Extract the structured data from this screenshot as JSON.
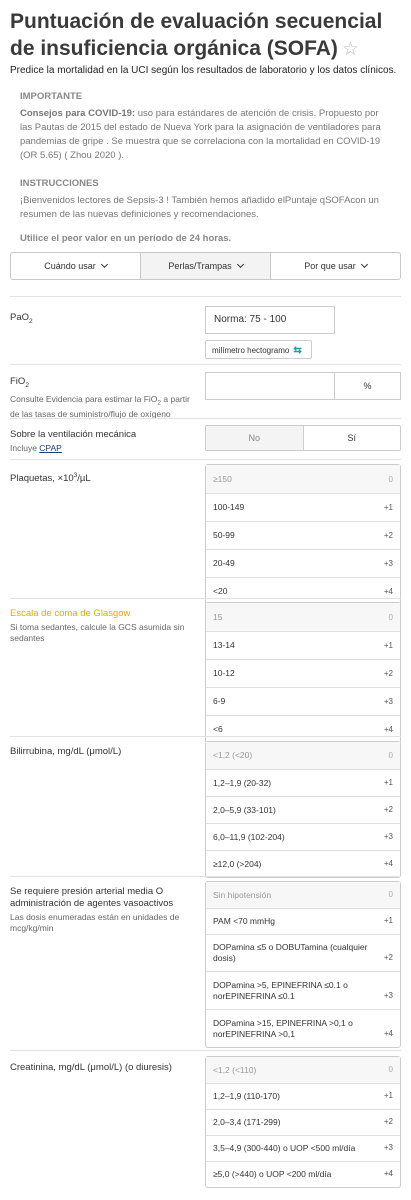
{
  "header": {
    "title": "Puntuación de evaluación secuencial de insuficiencia orgánica (SOFA)",
    "star_icon": "star-outline-icon",
    "subtitle": "Predice la mortalidad en la UCI según los resultados de laboratorio y los datos clínicos."
  },
  "important": {
    "heading": "IMPORTANTE",
    "lead": "Consejos para COVID-19:",
    "text": " uso para estándares de atención de crisis. Propuesto por las Pautas de 2015 del estado de Nueva York para la asignación de ventiladores para pandemias de gripe . Se muestra que se correlaciona con la mortalidad en COVID-19 (OR 5.65) ( Zhou 2020 )."
  },
  "instructions": {
    "heading": "INSTRUCCIONES",
    "text": "¡Bienvenidos lectores de Sepsis-3 ! También hemos añadido elPuntaje qSOFAcon un resumen de las nuevas definiciones y recomendaciones.",
    "emphasis": "Utilice el peor valor en un período de 24 horas."
  },
  "tabs": [
    {
      "label": "Cuándo usar"
    },
    {
      "label": "Perlas/Trampas"
    },
    {
      "label": "Por que usar"
    }
  ],
  "pao2": {
    "label_main": "PaO",
    "label_sub": "2",
    "placeholder": "Norma: 75 - 100",
    "unit": "milímetro hectogramo",
    "swap_icon": "swap-arrows-icon"
  },
  "fio2": {
    "label_main": "FiO",
    "label_sub": "2",
    "note_pre": "Consulte Evidencia para estimar la FiO",
    "note_sub": "2",
    "note_post": " a partir de las tasas de suministro/flujo de oxígeno",
    "unit": "%"
  },
  "ventilation": {
    "label": "Sobre la ventilación mecánica",
    "note_pre": "Incluye ",
    "note_link": "CPAP",
    "no": "No",
    "si": "Sí"
  },
  "platelets": {
    "label_pre": "Plaquetas, ×10",
    "label_sup": "3",
    "label_post": "/µL",
    "options": [
      {
        "label": "≥150",
        "points": "0"
      },
      {
        "label": "100-149",
        "points": "+1"
      },
      {
        "label": "50-99",
        "points": "+2"
      },
      {
        "label": "20-49",
        "points": "+3"
      },
      {
        "label": "<20",
        "points": "+4"
      }
    ]
  },
  "glasgow": {
    "label": "Escala de coma de Glasgow",
    "note": "Si toma sedantes, calcule la GCS asumida sin sedantes",
    "accent_color": "#f0a500",
    "options": [
      {
        "label": "15",
        "points": "0"
      },
      {
        "label": "13-14",
        "points": "+1"
      },
      {
        "label": "10-12",
        "points": "+2"
      },
      {
        "label": "6-9",
        "points": "+3"
      },
      {
        "label": "<6",
        "points": "+4"
      }
    ]
  },
  "bilirubin": {
    "label": "Bilirrubina, mg/dL (μmol/L)",
    "options": [
      {
        "label": "<1,2 (<20)",
        "points": "0"
      },
      {
        "label": "1,2–1,9 (20-32)",
        "points": "+1"
      },
      {
        "label": "2,0–5,9 (33-101)",
        "points": "+2"
      },
      {
        "label": "6,0–11,9 (102-204)",
        "points": "+3"
      },
      {
        "label": "≥12,0 (>204)",
        "points": "+4"
      }
    ]
  },
  "map": {
    "label": "Se requiere presión arterial media O administración de agentes vasoactivos",
    "note": "Las dosis enumeradas están en unidades de mcg/kg/min",
    "options": [
      {
        "label": "Sin hipotensión",
        "points": "0"
      },
      {
        "label": "PAM <70 mmHg",
        "points": "+1"
      },
      {
        "label": "DOPamina ≤5 o DOBUTamina (cualquier dosis)",
        "points": "+2"
      },
      {
        "label": "DOPamina >5, EPINEFRINA ≤0.1 o norEPINEFRINA ≤0.1",
        "points": "+3"
      },
      {
        "label": "DOPamina >15, EPINEFRINA >0,1 o norEPINEFRINA >0,1",
        "points": "+4"
      }
    ]
  },
  "creatinine": {
    "label": "Creatinina, mg/dL (μmol/L) (o diuresis)",
    "options": [
      {
        "label": "<1,2 (<110)",
        "points": "0"
      },
      {
        "label": "1,2–1,9 (110-170)",
        "points": "+1"
      },
      {
        "label": "2,0–3,4 (171-299)",
        "points": "+2"
      },
      {
        "label": "3,5–4,9 (300-440) o UOP <500 ml/día",
        "points": "+3"
      },
      {
        "label": "≥5,0 (>440) o UOP <200 ml/día",
        "points": "+4"
      }
    ]
  }
}
